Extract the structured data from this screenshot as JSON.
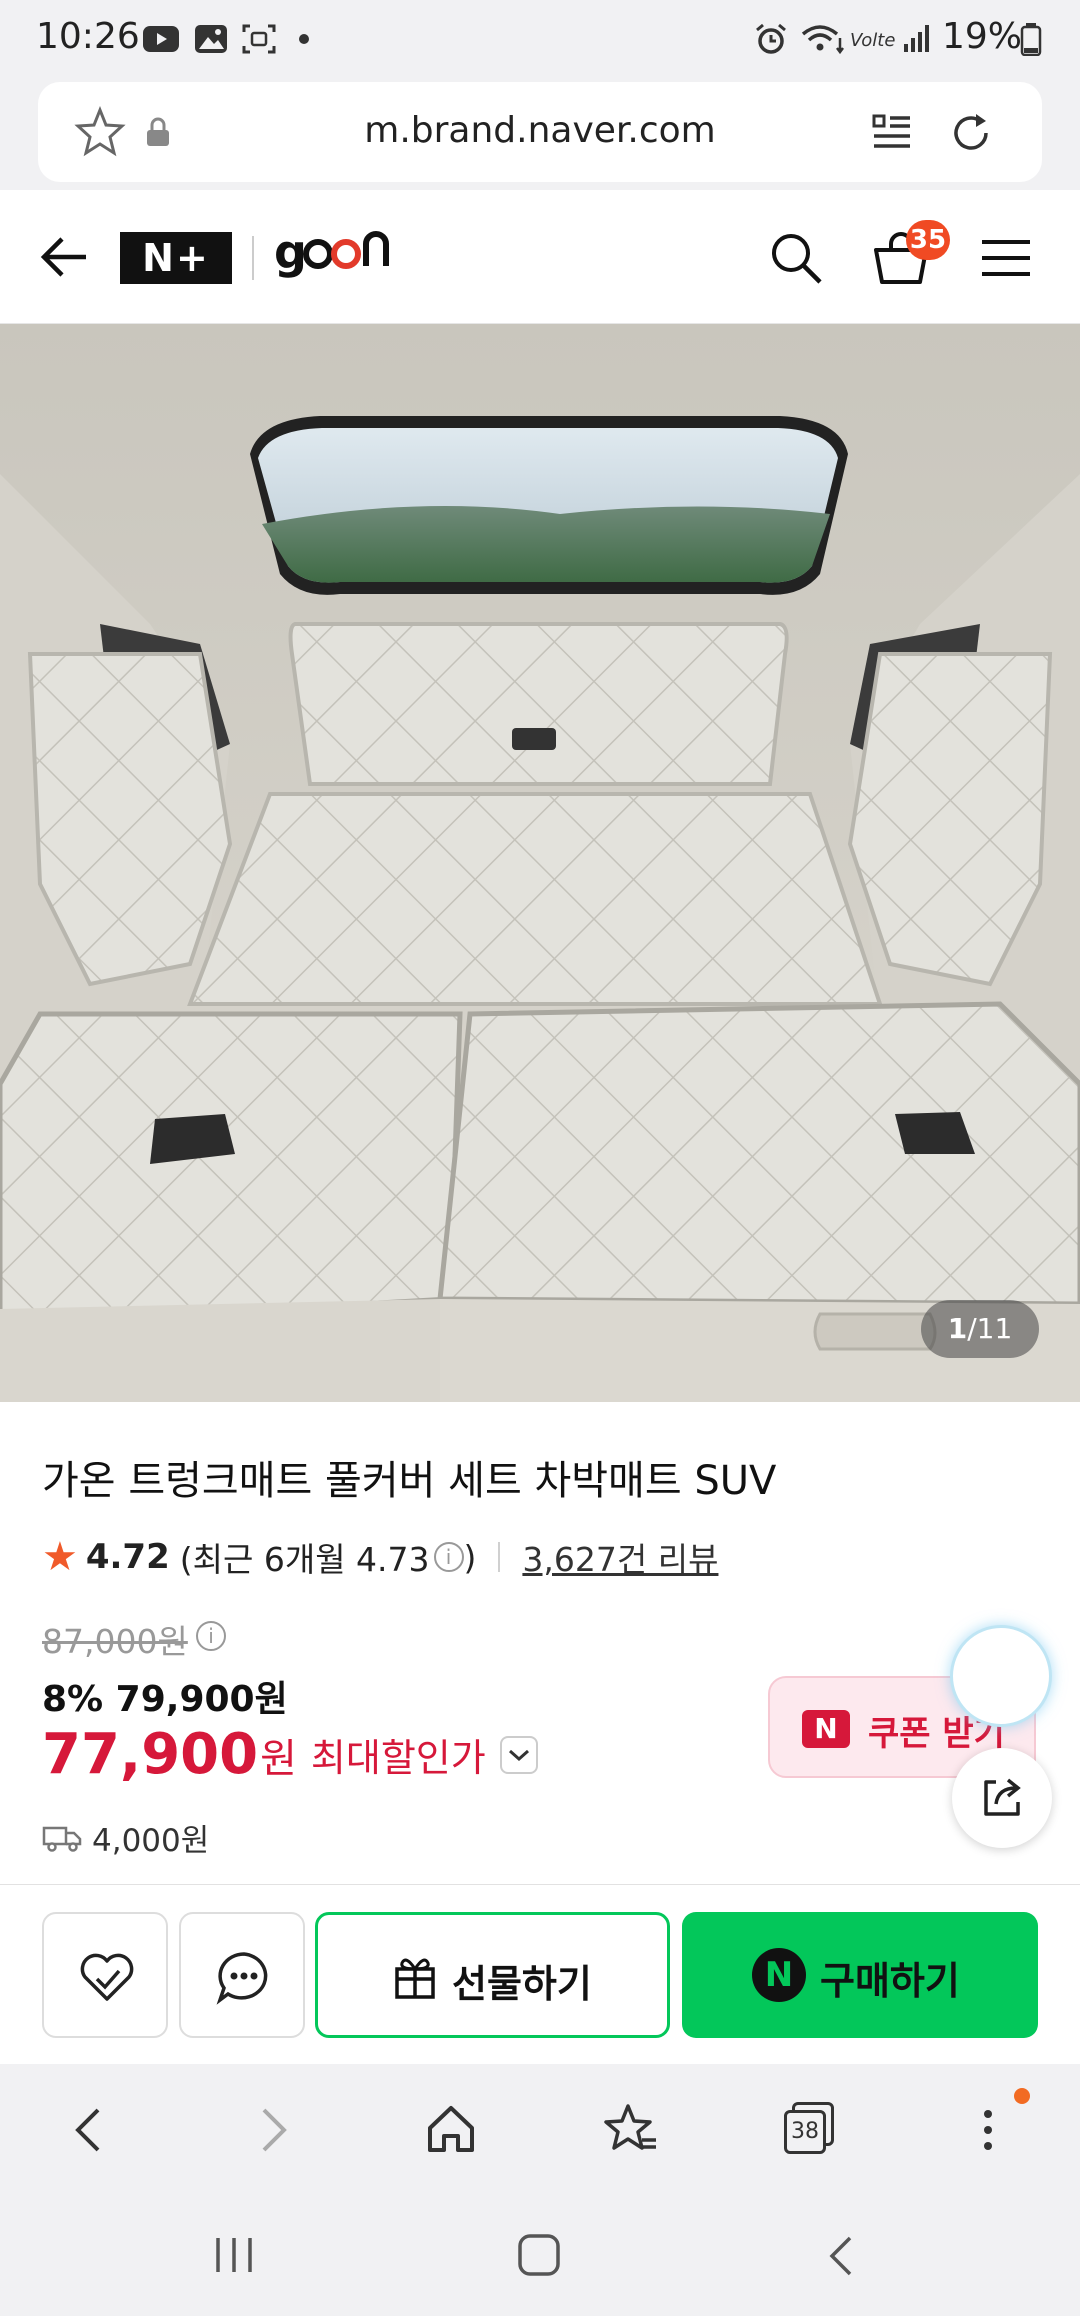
{
  "status_bar": {
    "time": "10:26",
    "battery": "19%",
    "icons": [
      "youtube-icon",
      "gallery-icon",
      "screenshot-icon",
      "dot-icon",
      "alarm-icon",
      "wifi-icon",
      "volte-icon",
      "signal-icon",
      "battery-icon"
    ]
  },
  "url_bar": {
    "url": "m.brand.naver.com",
    "icons": [
      "favorite-star-icon",
      "lock-icon",
      "reader-icon",
      "reload-icon"
    ]
  },
  "header": {
    "logo_n_plus": "N+",
    "brand_logo": "gaon",
    "cart_count": "35",
    "icons": [
      "back-arrow-icon",
      "search-icon",
      "cart-icon",
      "menu-icon"
    ]
  },
  "gallery": {
    "current": "1",
    "total": "/11"
  },
  "product": {
    "title": "가온 트렁크매트 풀커버 세트 차박매트 SUV",
    "rating": "4.72",
    "recent_rating": "(최근 6개월 4.73",
    "recent_rating_close": ")",
    "review_count": "3,627건 리뷰",
    "original_price": "87,000원",
    "discount_rate": "8%",
    "sale_price": "79,900원",
    "max_discount_price": "77,900",
    "max_discount_won": "원",
    "max_discount_label": "최대할인가",
    "shipping_fee": "4,000원"
  },
  "coupon": {
    "label": "쿠폰 받기"
  },
  "actions": {
    "gift_label": "선물하기",
    "buy_label": "구매하기"
  },
  "browser_nav": {
    "tabs_count": "38"
  },
  "colors": {
    "naver_green": "#03c75a",
    "price_red": "#d6183a",
    "star_orange": "#f05a2a",
    "cart_badge": "#f04a23"
  }
}
